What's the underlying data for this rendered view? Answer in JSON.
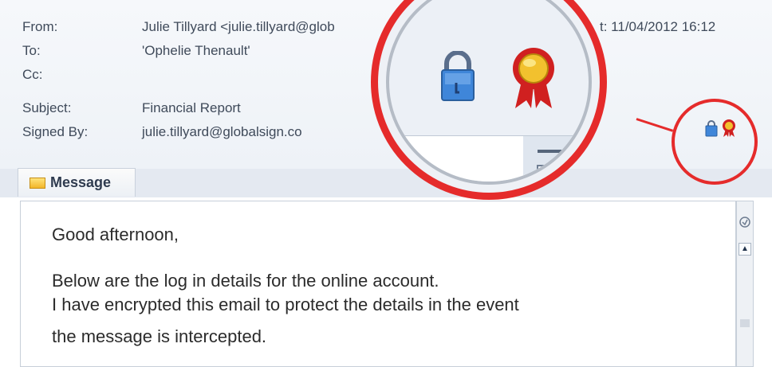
{
  "header": {
    "from_label": "From:",
    "from_value": "Julie Tillyard <julie.tillyard@glob",
    "sent_value": "t: 11/04/2012 16:12",
    "to_label": "To:",
    "to_value": "'Ophelie Thenault'",
    "cc_label": "Cc:",
    "subject_label": "Subject:",
    "subject_value": "Financial Report",
    "signed_label": "Signed By:",
    "signed_value": "julie.tillyard@globalsign.co"
  },
  "tabs": {
    "message_label": "Message"
  },
  "body": {
    "greeting": "Good afternoon,",
    "line1": "Below are the log in details for the online account.",
    "line2": "I have encrypted this email to protect the details in the event",
    "line3": "the message is intercepted."
  },
  "icons": {
    "encryption": "lock-icon",
    "signature": "award-ribbon-icon",
    "attachment_tab": "envelope-icon"
  },
  "colors": {
    "highlight": "#e52b2b",
    "lock": "#3f86d9",
    "seal": "#f2c12e",
    "ribbon": "#d02020"
  }
}
